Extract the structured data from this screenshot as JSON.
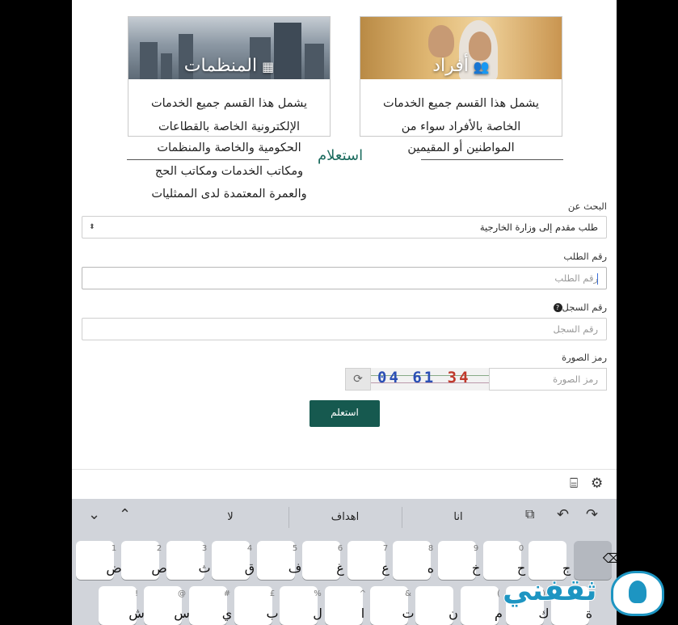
{
  "cards": {
    "organizations": {
      "title": "المنظمات",
      "icon": "building-icon",
      "description_lines": [
        "يشمل هذا القسم جميع الخدمات",
        "الإلكترونية الخاصة بالقطاعات",
        "الحكومية والخاصة والمنظمات",
        "ومكاتب الخدمات ومكاتب الحج",
        "والعمرة المعتمدة لدى الممثليات"
      ]
    },
    "individuals": {
      "title": "أفراد",
      "icon": "users-icon",
      "description_lines": [
        "يشمل هذا القسم جميع الخدمات",
        "الخاصة بالأفراد سواء من",
        "المواطنين أو المقيمين"
      ]
    }
  },
  "inquiry": {
    "heading": "استعلام",
    "search_for_label": "البحث عن",
    "search_for_value": "طلب مقدم إلى وزارة الخارجية",
    "request_number_label": "رقم الطلب",
    "request_number_placeholder": "رقم الطلب",
    "record_number_label": "رقم السجل",
    "record_number_placeholder": "رقم السجل",
    "captcha_label": "رمز الصورة",
    "captcha_placeholder": "رمز الصورة",
    "captcha_text_a": "04 61",
    "captcha_text_b": " 34",
    "submit_label": "استعلم"
  },
  "keyboard": {
    "suggestions": [
      "انا",
      "اهداف",
      "لا"
    ],
    "row1": [
      {
        "hint": "1",
        "key": "ض"
      },
      {
        "hint": "2",
        "key": "ص"
      },
      {
        "hint": "3",
        "key": "ث"
      },
      {
        "hint": "4",
        "key": "ق"
      },
      {
        "hint": "5",
        "key": "ف"
      },
      {
        "hint": "6",
        "key": "غ"
      },
      {
        "hint": "7",
        "key": "ع"
      },
      {
        "hint": "8",
        "key": "ه"
      },
      {
        "hint": "9",
        "key": "خ"
      },
      {
        "hint": "0",
        "key": "ح"
      },
      {
        "hint": "",
        "key": "ج"
      }
    ],
    "row2": [
      {
        "hint": "!",
        "key": "ش"
      },
      {
        "hint": "@",
        "key": "س"
      },
      {
        "hint": "#",
        "key": "ي"
      },
      {
        "hint": "£",
        "key": "ب"
      },
      {
        "hint": "%",
        "key": "ل"
      },
      {
        "hint": "^",
        "key": "ا"
      },
      {
        "hint": "&",
        "key": "ت"
      },
      {
        "hint": "",
        "key": "ن"
      },
      {
        "hint": "(",
        "key": "م"
      },
      {
        "hint": ")",
        "key": "ك"
      },
      {
        "hint": "",
        "key": "ة"
      }
    ]
  },
  "watermark": "ثقفني"
}
